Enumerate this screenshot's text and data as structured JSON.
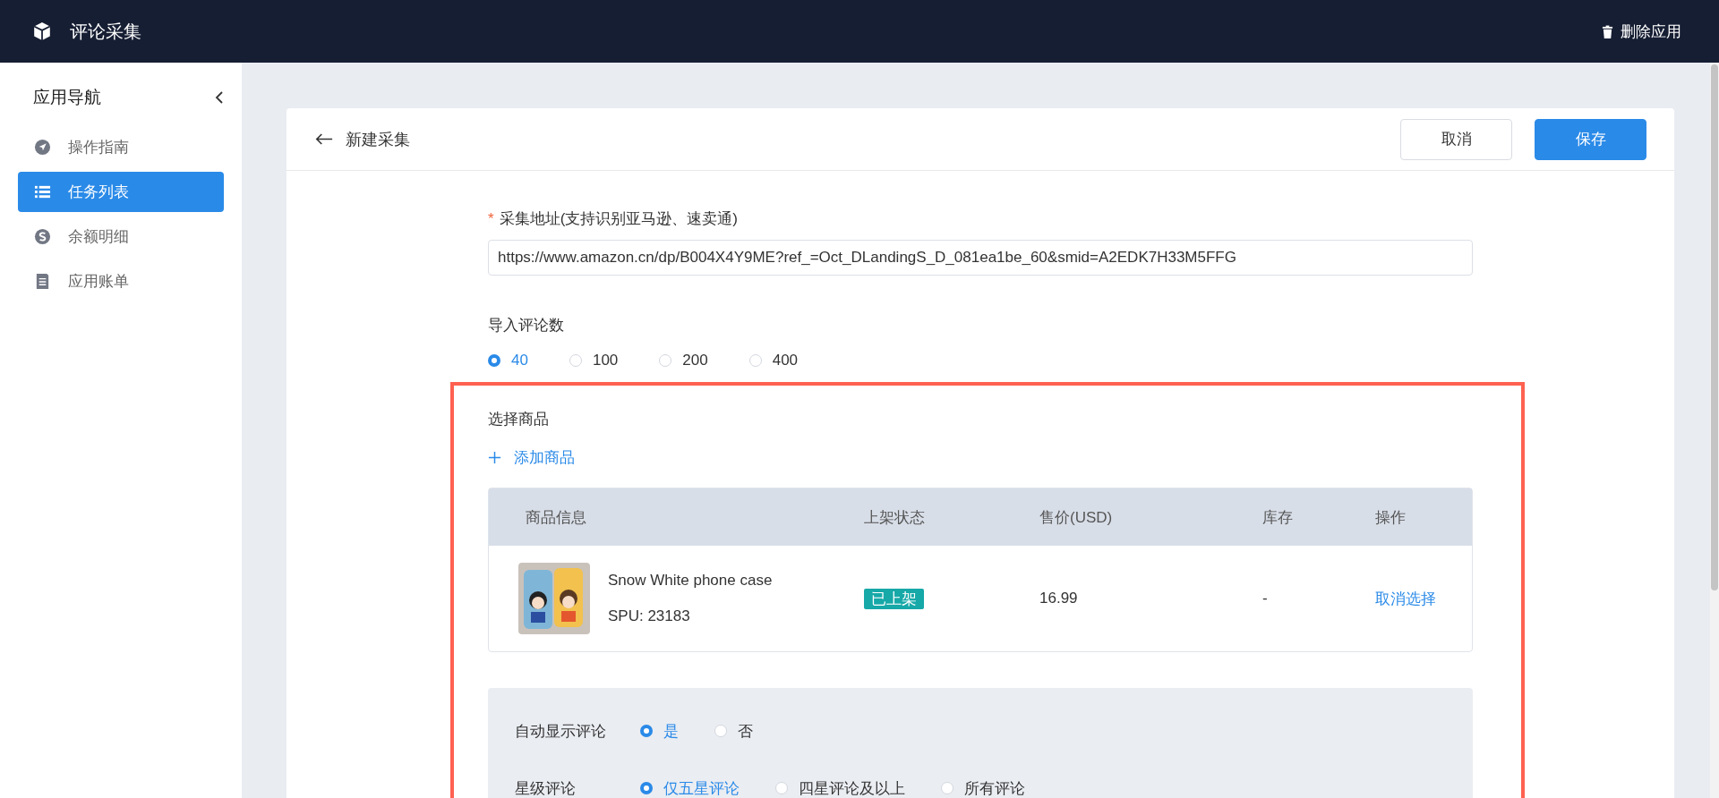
{
  "app": {
    "title": "评论采集",
    "delete_button": "删除应用"
  },
  "sidebar": {
    "title": "应用导航",
    "items": [
      {
        "label": "操作指南",
        "selected": false
      },
      {
        "label": "任务列表",
        "selected": true
      },
      {
        "label": "余额明细",
        "selected": false
      },
      {
        "label": "应用账单",
        "selected": false
      }
    ]
  },
  "form": {
    "title": "新建采集",
    "cancel_button": "取消",
    "save_button": "保存",
    "url": {
      "label": "采集地址(支持识别亚马逊、速卖通)",
      "required_mark": "*",
      "value": "https://www.amazon.cn/dp/B004X4Y9ME?ref_=Oct_DLandingS_D_081ea1be_60&smid=A2EDK7H33M5FFG"
    },
    "review_count": {
      "label": "导入评论数",
      "options": [
        {
          "label": "40",
          "selected": true
        },
        {
          "label": "100",
          "selected": false
        },
        {
          "label": "200",
          "selected": false
        },
        {
          "label": "400",
          "selected": false
        }
      ]
    },
    "products": {
      "label": "选择商品",
      "add_button": "添加商品",
      "columns": [
        "商品信息",
        "上架状态",
        "售价(USD)",
        "库存",
        "操作"
      ],
      "rows": [
        {
          "name": "Snow White phone case",
          "spu": "SPU: 23183",
          "status": "已上架",
          "price": "16.99",
          "stock": "-",
          "action": "取消选择"
        }
      ]
    },
    "settings": [
      {
        "label": "自动显示评论",
        "options": [
          {
            "label": "是",
            "selected": true
          },
          {
            "label": "否",
            "selected": false
          }
        ]
      },
      {
        "label": "星级评论",
        "options": [
          {
            "label": "仅五星评论",
            "selected": true
          },
          {
            "label": "四星评论及以上",
            "selected": false
          },
          {
            "label": "所有评论",
            "selected": false
          }
        ]
      }
    ]
  }
}
